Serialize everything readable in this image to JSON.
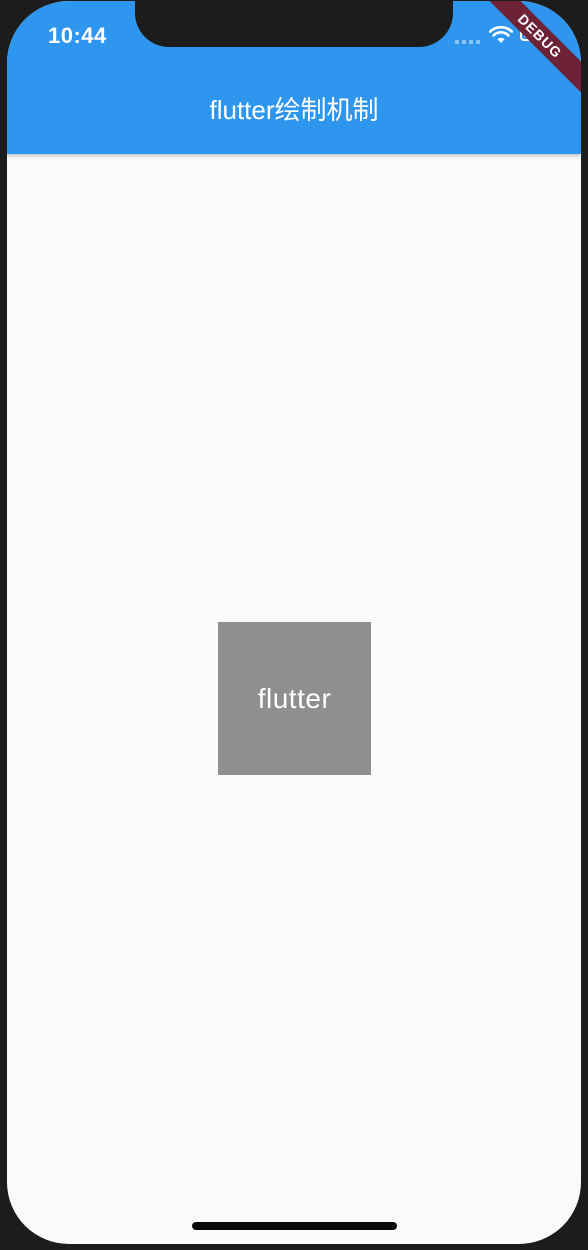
{
  "status_bar": {
    "time": "10:44",
    "wifi_icon": "wifi-icon",
    "battery_icon": "battery-icon"
  },
  "app_bar": {
    "title": "flutter绘制机制",
    "background_color": "#2e96ee"
  },
  "debug_banner": {
    "label": "DEBUG",
    "color": "#6e2238"
  },
  "content": {
    "box_label": "flutter",
    "box_color": "#8f8f8f",
    "page_background": "#fafafa"
  }
}
